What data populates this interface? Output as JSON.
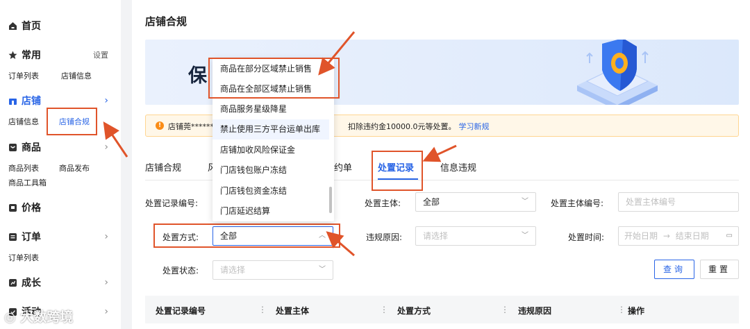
{
  "sidebar": {
    "home": {
      "label": "首页"
    },
    "common": {
      "label": "常用",
      "extra": "设置",
      "items": [
        "订单列表",
        "店铺信息"
      ]
    },
    "store": {
      "label": "店铺",
      "items": [
        "店铺信息",
        "店铺合规"
      ]
    },
    "goods": {
      "label": "商品",
      "items": [
        "商品列表",
        "商品发布",
        "商品工具箱"
      ]
    },
    "price": {
      "label": "价格"
    },
    "orders": {
      "label": "订单",
      "items": [
        "订单列表"
      ]
    },
    "growth": {
      "label": "成长"
    },
    "activity": {
      "label": "活动"
    }
  },
  "page": {
    "title": "店铺合规",
    "banner_text": "保持续增长",
    "notice": {
      "prefix": "店铺莞******",
      "suffix": "扣除违约金10000.0元等处置。",
      "link": "学习新规"
    }
  },
  "tabs": [
    "店铺合规",
    "风",
    "约单",
    "处置记录",
    "信息违规"
  ],
  "active_tab": "处置记录",
  "filters": {
    "record_no": {
      "label": "处置记录编号:"
    },
    "subject": {
      "label": "处置主体:",
      "value": "全部"
    },
    "subject_no": {
      "label": "处置主体编号:",
      "placeholder": "处置主体编号"
    },
    "method": {
      "label": "处置方式:",
      "value": "全部"
    },
    "reason": {
      "label": "违规原因:",
      "placeholder": "请选择"
    },
    "time": {
      "label": "处置时间:",
      "start": "开始日期",
      "end": "结束日期"
    },
    "status": {
      "label": "处置状态:",
      "placeholder": "请选择"
    },
    "query_btn": "查询",
    "reset_btn": "重置"
  },
  "dropdown_options": [
    "商品在部分区域禁止销售",
    "商品在全部区域禁止销售",
    "商品服务星级降星",
    "禁止使用三方平台运单出库",
    "店铺加收风险保证金",
    "门店钱包账户冻结",
    "门店钱包资金冻结",
    "门店延迟结算"
  ],
  "table_headers": [
    "处置记录编号",
    "处置主体",
    "处置方式",
    "违规原因",
    "操作"
  ],
  "watermark": "大数跨境",
  "colors": {
    "accent": "#2864e6",
    "highlight": "#e0542a",
    "notice_bg": "#fff7e8"
  }
}
